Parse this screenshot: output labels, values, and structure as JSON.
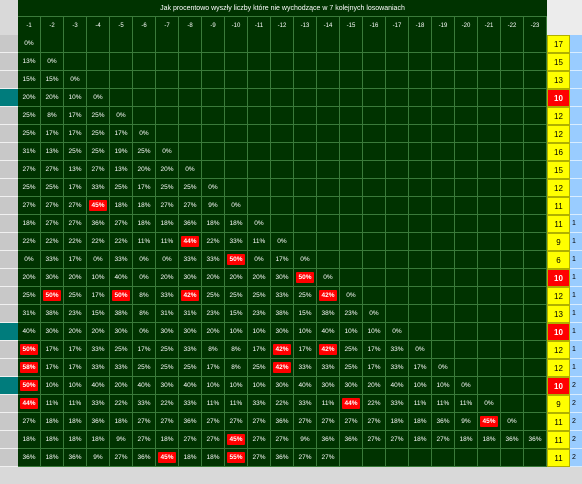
{
  "title": "Jak procentowo wyszły liczby które nie wychodzące w 7 kolejnych losowaniach",
  "colors": {
    "panel": "#003300",
    "grid": "#3a7a3a",
    "hot": "#ff0000",
    "count_bg": "#ffff00",
    "row_header": "#c8c8c8",
    "row_header_teal": "#007c7c",
    "side_blue": "#99ccff"
  },
  "columns": [
    "-1",
    "-2",
    "-3",
    "-4",
    "-5",
    "-6",
    "-7",
    "-8",
    "-9",
    "-10",
    "-11",
    "-12",
    "-13",
    "-14",
    "-15",
    "-16",
    "-17",
    "-18",
    "-19",
    "-20",
    "-21",
    "-22",
    "-23"
  ],
  "rows": [
    {
      "cells": [
        "0%"
      ],
      "count": "17",
      "hot": [],
      "teal": false,
      "extra": ""
    },
    {
      "cells": [
        "13%",
        "0%"
      ],
      "count": "15",
      "hot": [],
      "teal": false,
      "extra": ""
    },
    {
      "cells": [
        "15%",
        "15%",
        "0%"
      ],
      "count": "13",
      "hot": [],
      "teal": false,
      "extra": ""
    },
    {
      "cells": [
        "20%",
        "20%",
        "10%",
        "0%"
      ],
      "count": "10",
      "hot": [],
      "teal": true,
      "extra": ""
    },
    {
      "cells": [
        "25%",
        "8%",
        "17%",
        "25%",
        "0%"
      ],
      "count": "12",
      "hot": [],
      "teal": false,
      "extra": ""
    },
    {
      "cells": [
        "25%",
        "17%",
        "17%",
        "25%",
        "17%",
        "0%"
      ],
      "count": "12",
      "hot": [],
      "teal": false,
      "extra": ""
    },
    {
      "cells": [
        "31%",
        "13%",
        "25%",
        "25%",
        "19%",
        "25%",
        "0%"
      ],
      "count": "16",
      "hot": [],
      "teal": false,
      "extra": ""
    },
    {
      "cells": [
        "27%",
        "27%",
        "13%",
        "27%",
        "13%",
        "20%",
        "20%",
        "0%"
      ],
      "count": "15",
      "hot": [],
      "teal": false,
      "extra": ""
    },
    {
      "cells": [
        "25%",
        "25%",
        "17%",
        "33%",
        "25%",
        "17%",
        "25%",
        "25%",
        "0%"
      ],
      "count": "12",
      "hot": [],
      "teal": false,
      "extra": ""
    },
    {
      "cells": [
        "27%",
        "27%",
        "27%",
        "45%",
        "18%",
        "18%",
        "27%",
        "27%",
        "9%",
        "0%"
      ],
      "count": "11",
      "hot": [
        3
      ],
      "teal": false,
      "extra": ""
    },
    {
      "cells": [
        "18%",
        "27%",
        "27%",
        "36%",
        "27%",
        "18%",
        "18%",
        "36%",
        "18%",
        "18%",
        "0%"
      ],
      "count": "11",
      "hot": [],
      "teal": false,
      "extra": "1"
    },
    {
      "cells": [
        "22%",
        "22%",
        "22%",
        "22%",
        "22%",
        "11%",
        "11%",
        "44%",
        "22%",
        "33%",
        "11%",
        "0%"
      ],
      "count": "9",
      "hot": [
        7
      ],
      "teal": false,
      "extra": "1"
    },
    {
      "cells": [
        "0%",
        "33%",
        "17%",
        "0%",
        "33%",
        "0%",
        "0%",
        "33%",
        "33%",
        "50%",
        "0%",
        "17%",
        "0%"
      ],
      "count": "6",
      "hot": [
        9
      ],
      "teal": false,
      "extra": "1"
    },
    {
      "cells": [
        "20%",
        "30%",
        "20%",
        "10%",
        "40%",
        "0%",
        "20%",
        "30%",
        "20%",
        "20%",
        "20%",
        "30%",
        "50%",
        "0%"
      ],
      "count": "10",
      "hot": [
        12
      ],
      "teal": false,
      "extra": "1"
    },
    {
      "cells": [
        "25%",
        "50%",
        "25%",
        "17%",
        "50%",
        "8%",
        "33%",
        "42%",
        "25%",
        "25%",
        "25%",
        "33%",
        "25%",
        "42%",
        "0%"
      ],
      "count": "12",
      "hot": [
        1,
        4,
        7,
        13
      ],
      "teal": false,
      "extra": "1"
    },
    {
      "cells": [
        "31%",
        "38%",
        "23%",
        "15%",
        "38%",
        "8%",
        "31%",
        "31%",
        "23%",
        "15%",
        "23%",
        "38%",
        "15%",
        "38%",
        "23%",
        "0%"
      ],
      "count": "13",
      "hot": [],
      "teal": false,
      "extra": "1"
    },
    {
      "cells": [
        "40%",
        "30%",
        "20%",
        "20%",
        "30%",
        "0%",
        "30%",
        "30%",
        "20%",
        "10%",
        "10%",
        "30%",
        "10%",
        "40%",
        "10%",
        "10%",
        "0%"
      ],
      "count": "10",
      "hot": [],
      "teal": true,
      "extra": "1"
    },
    {
      "cells": [
        "50%",
        "17%",
        "17%",
        "33%",
        "25%",
        "17%",
        "25%",
        "33%",
        "8%",
        "8%",
        "17%",
        "42%",
        "17%",
        "42%",
        "25%",
        "17%",
        "33%",
        "0%"
      ],
      "count": "12",
      "hot": [
        0,
        11,
        13
      ],
      "teal": false,
      "extra": "1"
    },
    {
      "cells": [
        "58%",
        "17%",
        "17%",
        "33%",
        "33%",
        "25%",
        "25%",
        "25%",
        "17%",
        "8%",
        "25%",
        "42%",
        "33%",
        "33%",
        "25%",
        "17%",
        "33%",
        "17%",
        "0%"
      ],
      "count": "12",
      "hot": [
        0,
        11
      ],
      "teal": false,
      "extra": "1"
    },
    {
      "cells": [
        "50%",
        "10%",
        "10%",
        "40%",
        "20%",
        "40%",
        "30%",
        "40%",
        "10%",
        "10%",
        "10%",
        "30%",
        "40%",
        "30%",
        "30%",
        "20%",
        "40%",
        "10%",
        "10%",
        "0%"
      ],
      "count": "10",
      "hot": [
        0
      ],
      "teal": true,
      "extra": "2"
    },
    {
      "cells": [
        "44%",
        "11%",
        "11%",
        "33%",
        "22%",
        "33%",
        "22%",
        "33%",
        "11%",
        "11%",
        "33%",
        "22%",
        "33%",
        "11%",
        "44%",
        "22%",
        "33%",
        "11%",
        "11%",
        "11%",
        "0%"
      ],
      "count": "9",
      "hot": [
        0,
        14
      ],
      "teal": false,
      "extra": "2"
    },
    {
      "cells": [
        "27%",
        "18%",
        "18%",
        "36%",
        "18%",
        "27%",
        "27%",
        "36%",
        "27%",
        "27%",
        "27%",
        "36%",
        "27%",
        "27%",
        "27%",
        "27%",
        "18%",
        "18%",
        "36%",
        "9%",
        "45%",
        "0%"
      ],
      "count": "11",
      "hot": [
        20
      ],
      "teal": false,
      "extra": "2"
    },
    {
      "cells": [
        "18%",
        "18%",
        "18%",
        "18%",
        "9%",
        "27%",
        "18%",
        "27%",
        "27%",
        "45%",
        "27%",
        "27%",
        "9%",
        "36%",
        "36%",
        "27%",
        "27%",
        "18%",
        "27%",
        "18%",
        "18%",
        "36%",
        "36%"
      ],
      "count": "11",
      "hot": [
        9
      ],
      "teal": false,
      "extra": "2"
    },
    {
      "cells": [
        "36%",
        "18%",
        "36%",
        "9%",
        "27%",
        "36%",
        "45%",
        "18%",
        "18%",
        "55%",
        "27%",
        "36%",
        "27%",
        "27%"
      ],
      "count": "11",
      "hot": [
        6,
        9
      ],
      "teal": false,
      "extra": "2"
    }
  ]
}
